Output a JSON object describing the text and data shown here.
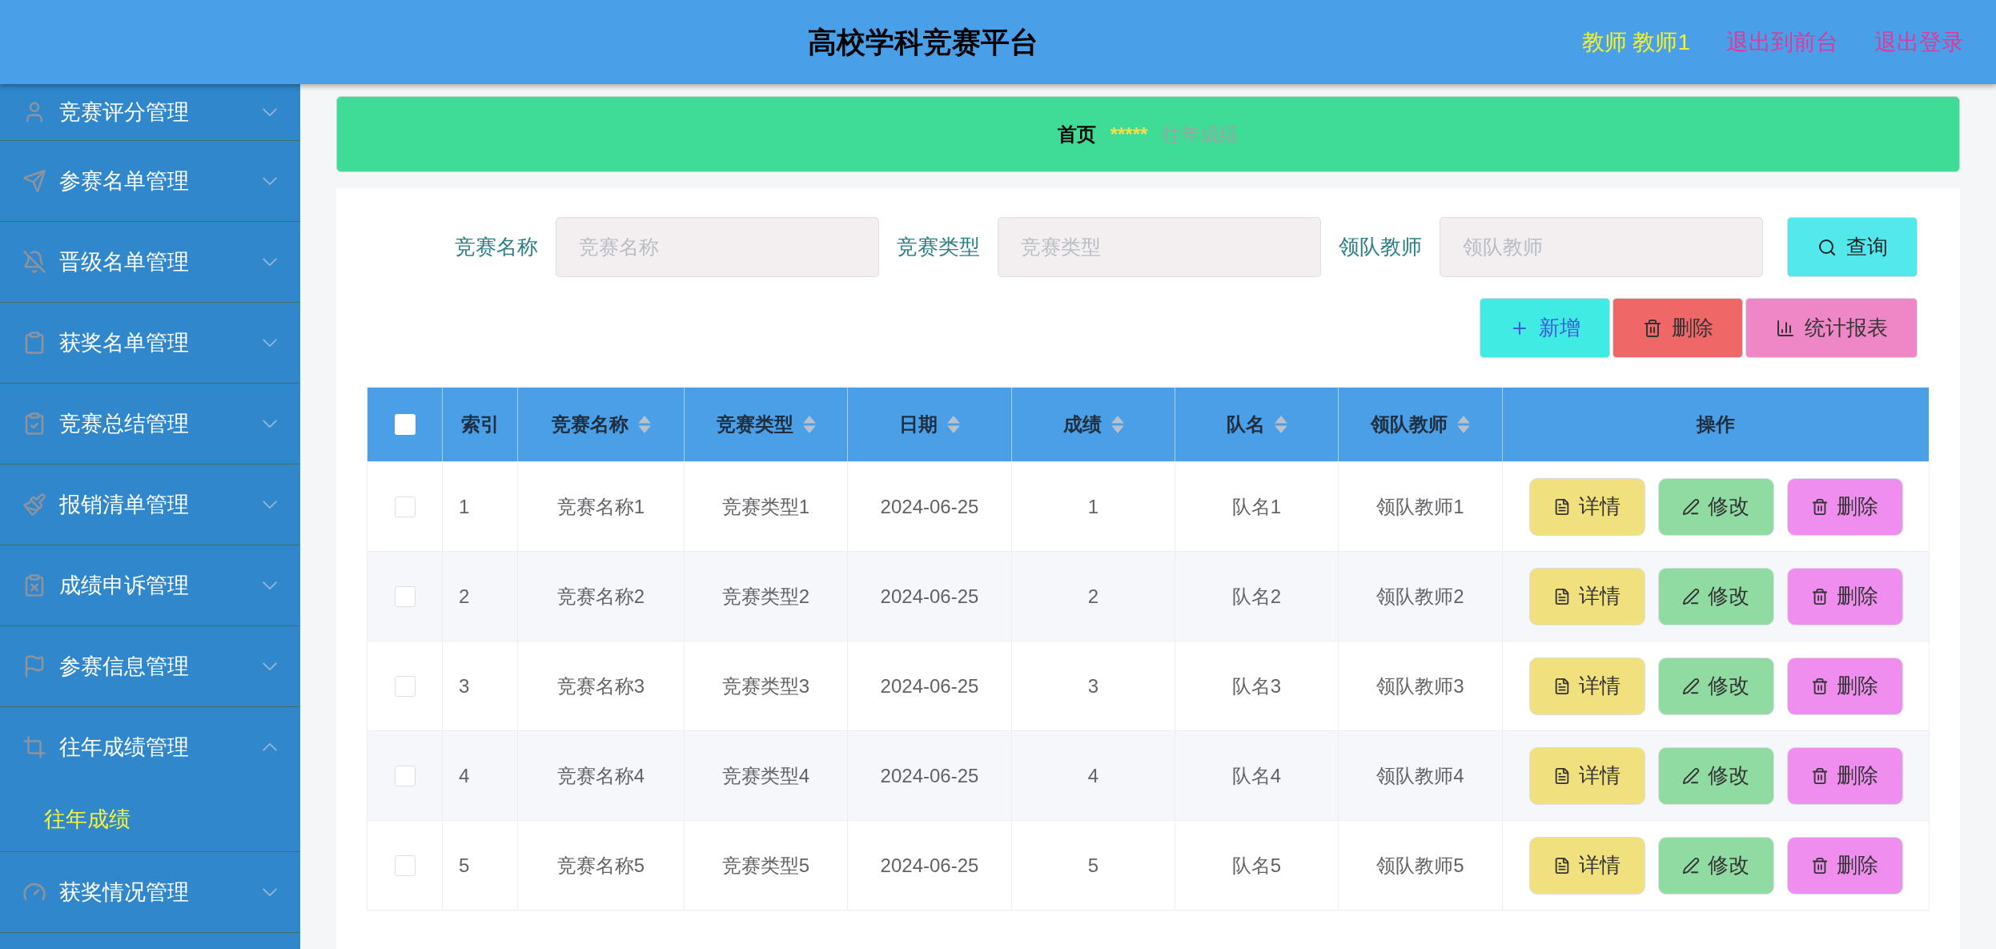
{
  "header": {
    "title": "高校学科竞赛平台",
    "user": "教师 教师1",
    "links": [
      "退出到前台",
      "退出登录"
    ]
  },
  "sidebar": {
    "items": [
      {
        "label": "竞赛评分管理",
        "expanded": false
      },
      {
        "label": "参赛名单管理",
        "expanded": false
      },
      {
        "label": "晋级名单管理",
        "expanded": false
      },
      {
        "label": "获奖名单管理",
        "expanded": false
      },
      {
        "label": "竞赛总结管理",
        "expanded": false
      },
      {
        "label": "报销清单管理",
        "expanded": false
      },
      {
        "label": "成绩申诉管理",
        "expanded": false
      },
      {
        "label": "参赛信息管理",
        "expanded": false
      },
      {
        "label": "往年成绩管理",
        "expanded": true,
        "children": [
          {
            "label": "往年成绩",
            "selected": true
          }
        ]
      },
      {
        "label": "获奖情况管理",
        "expanded": false
      }
    ]
  },
  "breadcrumb": {
    "home": "首页",
    "separator": "*****",
    "current": "往年成绩"
  },
  "search": {
    "fields": [
      {
        "label": "竞赛名称",
        "placeholder": "竞赛名称"
      },
      {
        "label": "竞赛类型",
        "placeholder": "竞赛类型"
      },
      {
        "label": "领队教师",
        "placeholder": "领队教师"
      }
    ],
    "button": "查询"
  },
  "actions": [
    {
      "kind": "add",
      "label": "新增"
    },
    {
      "kind": "delete",
      "label": "删除"
    },
    {
      "kind": "report",
      "label": "统计报表"
    }
  ],
  "table": {
    "select_all": {
      "checked": false
    },
    "columns": [
      {
        "label": "索引",
        "sortable": false
      },
      {
        "label": "竞赛名称",
        "sortable": true
      },
      {
        "label": "竞赛类型",
        "sortable": true
      },
      {
        "label": "日期",
        "sortable": true
      },
      {
        "label": "成绩",
        "sortable": true
      },
      {
        "label": "队名",
        "sortable": true
      },
      {
        "label": "领队教师",
        "sortable": true
      },
      {
        "label": "操作",
        "sortable": false
      }
    ],
    "rows": [
      {
        "checked": false,
        "cells": [
          "1",
          "竞赛名称1",
          "竞赛类型1",
          "2024-06-25",
          "1",
          "队名1",
          "领队教师1"
        ],
        "actions": [
          {
            "kind": "detail",
            "label": "详情"
          },
          {
            "kind": "edit",
            "label": "修改"
          },
          {
            "kind": "delete",
            "label": "删除"
          }
        ]
      },
      {
        "checked": false,
        "cells": [
          "2",
          "竞赛名称2",
          "竞赛类型2",
          "2024-06-25",
          "2",
          "队名2",
          "领队教师2"
        ],
        "actions": [
          {
            "kind": "detail",
            "label": "详情"
          },
          {
            "kind": "edit",
            "label": "修改"
          },
          {
            "kind": "delete",
            "label": "删除"
          }
        ]
      },
      {
        "checked": false,
        "cells": [
          "3",
          "竞赛名称3",
          "竞赛类型3",
          "2024-06-25",
          "3",
          "队名3",
          "领队教师3"
        ],
        "actions": [
          {
            "kind": "detail",
            "label": "详情"
          },
          {
            "kind": "edit",
            "label": "修改"
          },
          {
            "kind": "delete",
            "label": "删除"
          }
        ]
      },
      {
        "checked": false,
        "cells": [
          "4",
          "竞赛名称4",
          "竞赛类型4",
          "2024-06-25",
          "4",
          "队名4",
          "领队教师4"
        ],
        "actions": [
          {
            "kind": "detail",
            "label": "详情"
          },
          {
            "kind": "edit",
            "label": "修改"
          },
          {
            "kind": "delete",
            "label": "删除"
          }
        ]
      },
      {
        "checked": false,
        "cells": [
          "5",
          "竞赛名称5",
          "竞赛类型5",
          "2024-06-25",
          "5",
          "队名5",
          "领队教师5"
        ],
        "actions": [
          {
            "kind": "detail",
            "label": "详情"
          },
          {
            "kind": "edit",
            "label": "修改"
          },
          {
            "kind": "delete",
            "label": "删除"
          }
        ]
      }
    ]
  }
}
